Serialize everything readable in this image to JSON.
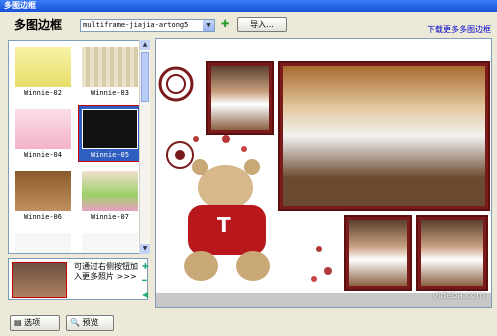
{
  "window": {
    "title": "多图边框"
  },
  "header": {
    "title": "多图边框",
    "frame_select_value": "multiframe-jiajia-artong5",
    "import_label": "导入...",
    "download_link": "下载更多多图边框"
  },
  "thumbnails": [
    {
      "label": "Winnie-02",
      "selected": false
    },
    {
      "label": "Winnie-03",
      "selected": false
    },
    {
      "label": "Winnie-04",
      "selected": false
    },
    {
      "label": "Winnie-05",
      "selected": true
    },
    {
      "label": "Winnie-06",
      "selected": false
    },
    {
      "label": "Winnie-07",
      "selected": false
    }
  ],
  "photo_strip": {
    "hint": "可通过右侧按钮加入更多照片 >>>"
  },
  "buttons": {
    "options_label": "选项",
    "preview_label": "预览"
  },
  "watermark": {
    "text": "yideba.com"
  },
  "colors": {
    "accent": "#2e5ec0",
    "frame": "#7a1a1a",
    "titlebar": "#1651d8"
  }
}
